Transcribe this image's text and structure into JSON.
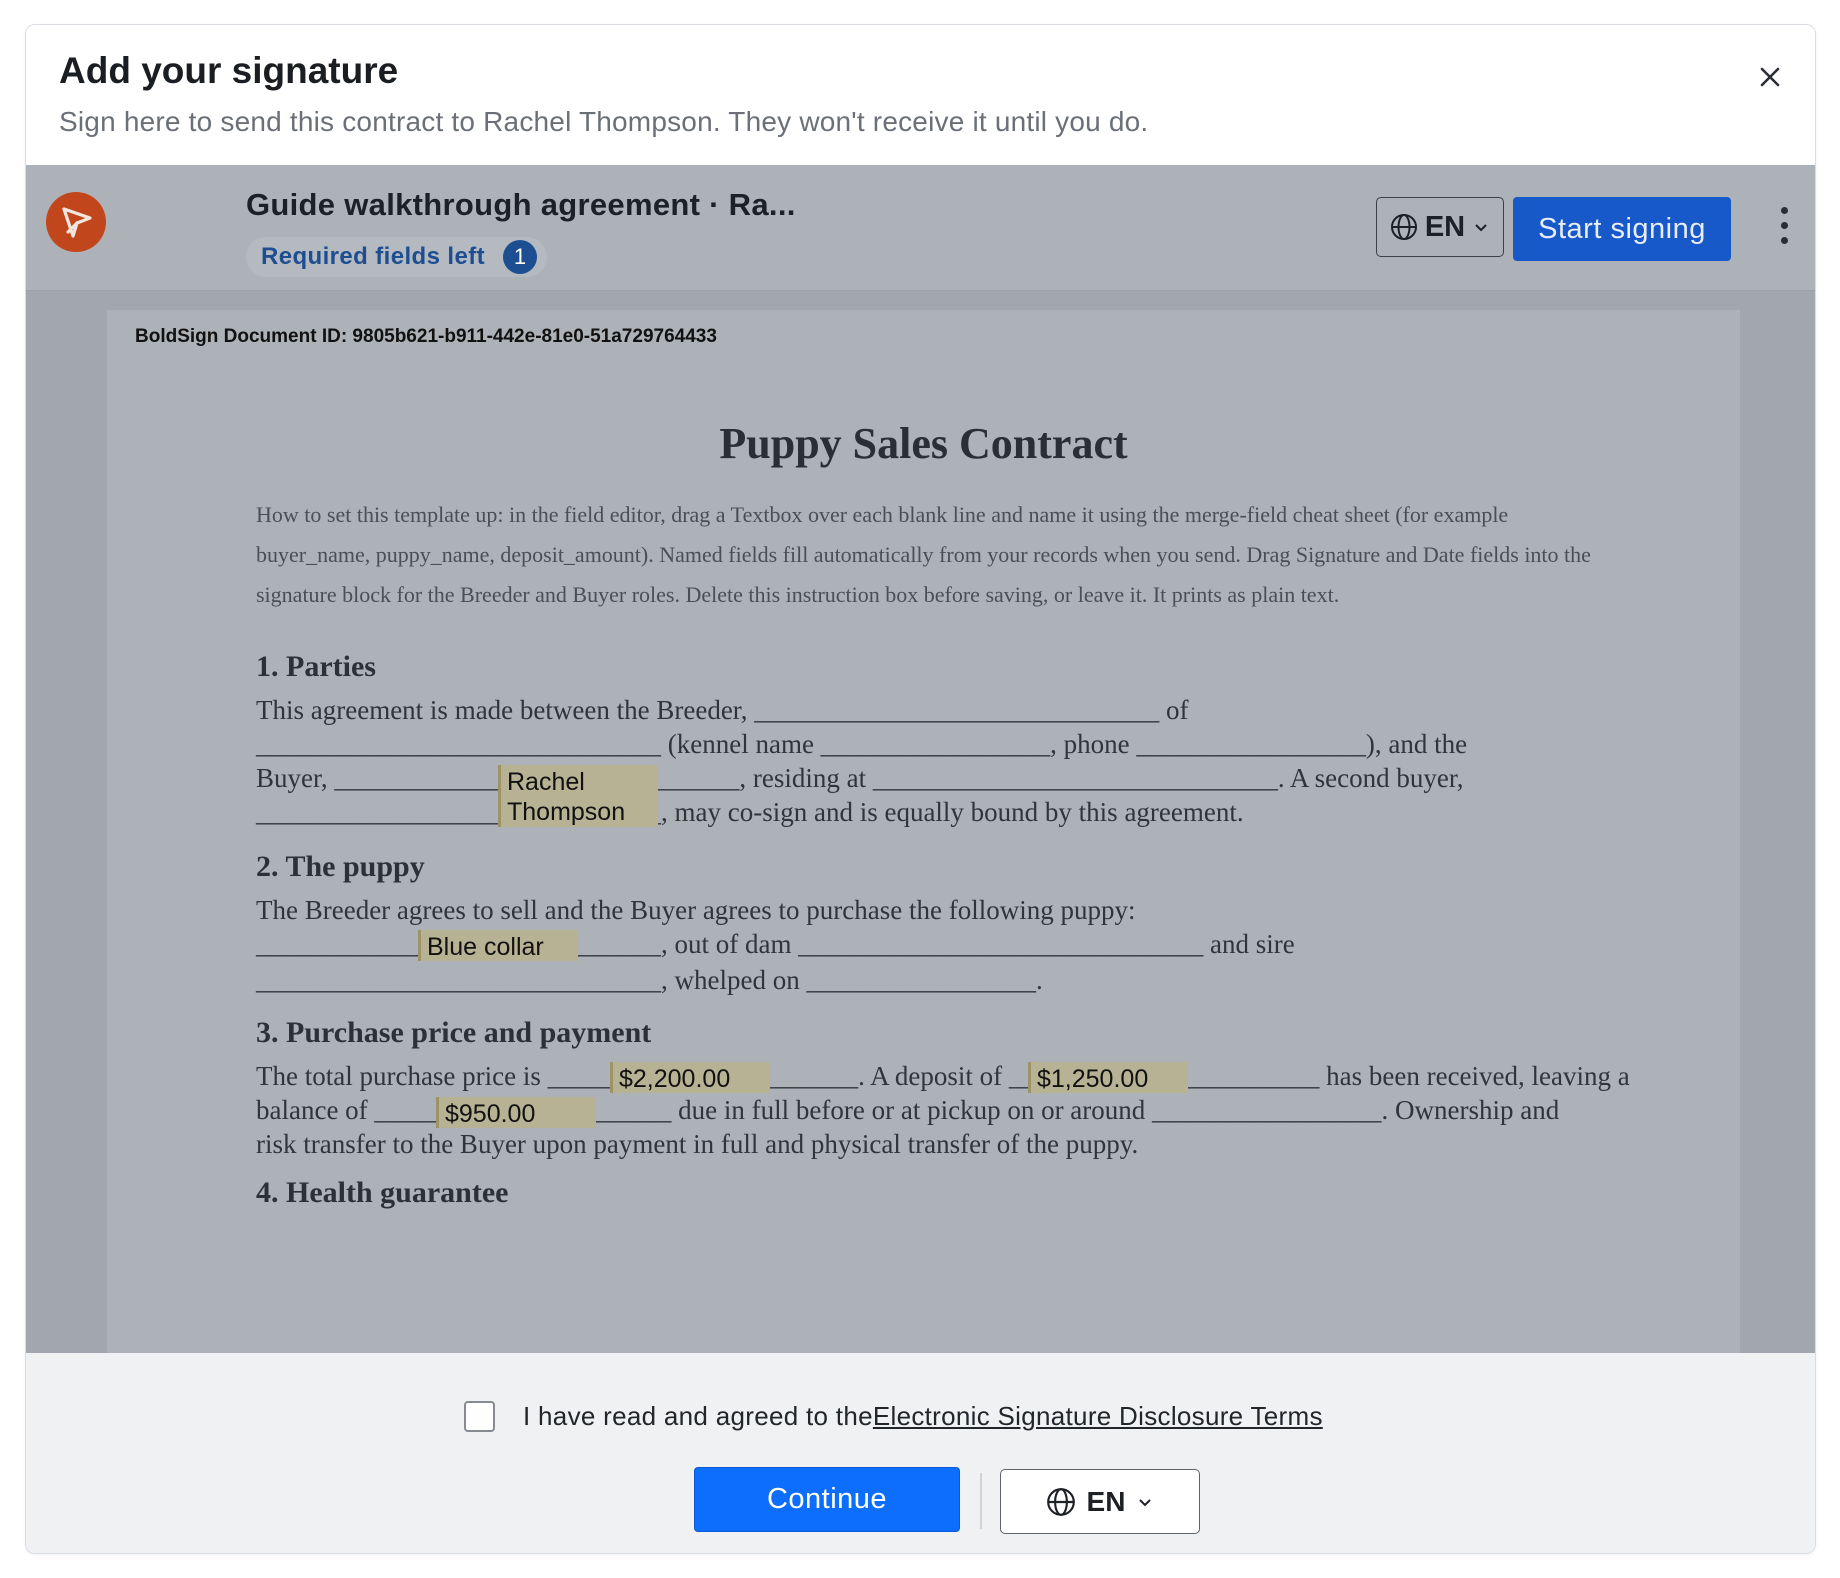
{
  "modal": {
    "title": "Add your signature",
    "subtitle": "Sign here to send this contract to Rachel Thompson. They won't receive it until you do."
  },
  "viewer": {
    "doc_title": "Guide walkthrough agreement · Ra...",
    "required_label": "Required fields left",
    "required_count": "1",
    "language": "EN",
    "start_label": "Start signing"
  },
  "document": {
    "doc_id": "BoldSign Document ID: 9805b621-b911-442e-81e0-51a729764433",
    "title": "Puppy Sales Contract",
    "instructions": "How to set this template up: in the field editor, drag a Textbox over each blank line and name it using the merge-field cheat sheet (for example buyer_name, puppy_name, deposit_amount). Named fields fill automatically from your records when you send. Drag Signature and Date fields into the signature block for the Breeder and Buyer roles. Delete this instruction box before saving, or leave it. It prints as plain text.",
    "sections": {
      "parties": {
        "heading": "1. Parties",
        "line1": "This agreement is made between the Breeder, ______________________________ of",
        "line2": "______________________________ (kennel name _________________, phone _________________), and the",
        "line3": "Buyer, ______________________________, residing at ______________________________. A second buyer,",
        "line4": "______________________________, may co-sign and is equally bound by this agreement."
      },
      "puppy": {
        "heading": "2. The puppy",
        "line1": "The Breeder agrees to sell and the Buyer agrees to purchase the following puppy:",
        "line2": "______________________________, out of dam ______________________________ and sire",
        "line3": "______________________________, whelped on _________________."
      },
      "price": {
        "heading": "3. Purchase price and payment",
        "line1": "The total purchase price is _______________________. A deposit of _______________________ has been received, leaving a",
        "line2": "balance of ______________________ due in full before or at pickup on or around _________________. Ownership and",
        "line3": "risk transfer to the Buyer upon payment in full and physical transfer of the puppy."
      },
      "health": {
        "heading": "4. Health guarantee"
      }
    },
    "fields": {
      "buyer_name": "Rachel Thompson",
      "puppy_name": "Blue collar",
      "total_price": "$2,200.00",
      "deposit": "$1,250.00",
      "balance": "$950.00"
    }
  },
  "footer": {
    "agree_prefix": "I have read and agreed to the ",
    "agree_link": "Electronic Signature Disclosure Terms",
    "continue_label": "Continue",
    "language": "EN"
  }
}
